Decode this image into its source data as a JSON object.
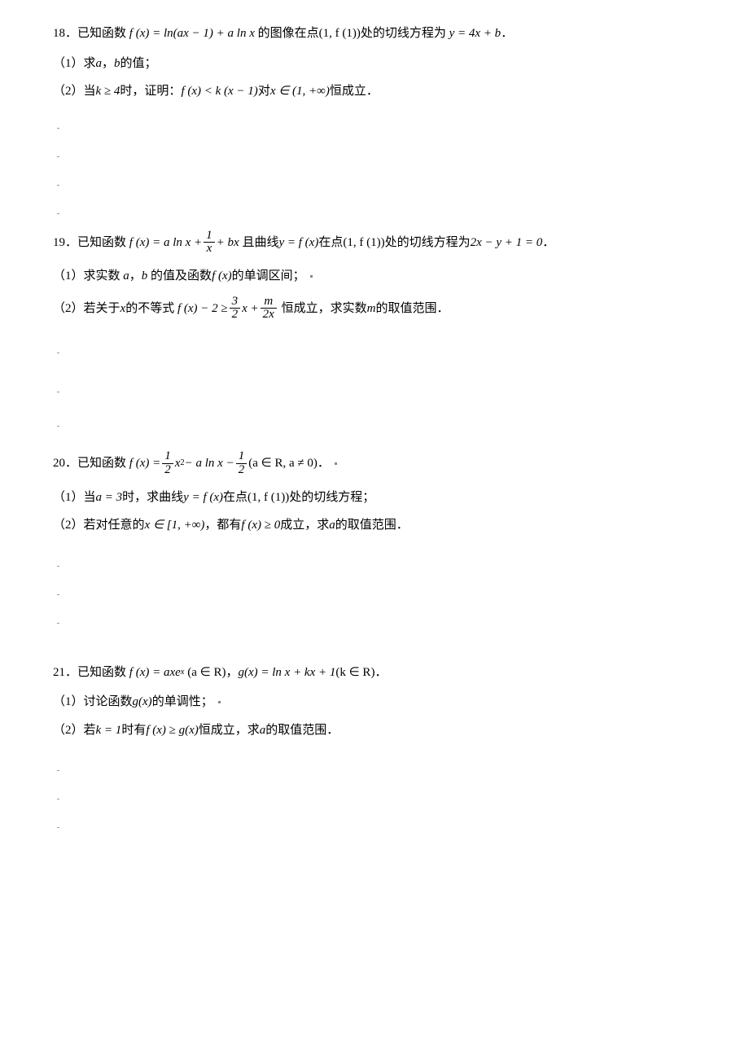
{
  "p18": {
    "num": "18．",
    "intro_a": "已知函数",
    "f_def": "f (x) = ln(ax − 1) + a ln x",
    "intro_b": "的图像在点",
    "point": "(1, f (1))",
    "intro_c": "处的切线方程为",
    "tangent": "y = 4x + b",
    "period": "．",
    "q1_label": "（1）",
    "q1_a": "求",
    "q1_var1": "a",
    "q1_comma": "，",
    "q1_var2": "b",
    "q1_b": "的值；",
    "q2_label": "（2）",
    "q2_a": "当",
    "q2_cond": "k ≥ 4",
    "q2_b": "时，证明：",
    "q2_ineq": "f (x) < k (x − 1)",
    "q2_c": "对",
    "q2_dom": "x ∈ (1, +∞)",
    "q2_d": "恒成立．"
  },
  "p19": {
    "num": "19．",
    "intro_a": "已知函数",
    "f_l": "f (x) = a ln x + ",
    "frac_num": "1",
    "frac_den": "x",
    "f_r": " + bx",
    "intro_b": "且曲线  ",
    "curve": "y = f (x)",
    "intro_c": "在点",
    "point": "(1, f (1))",
    "intro_d": "处的切线方程为",
    "tangent": "2x − y + 1 = 0",
    "period": "．",
    "q1_label": "（1）",
    "q1_a": "求实数",
    "q1_var1": "a",
    "q1_comma": "，",
    "q1_var2": "b",
    "q1_b": "的值及函数",
    "q1_fx": "f (x)",
    "q1_c": "的单调区间；",
    "q2_label": "（2）",
    "q2_a": "若关于",
    "q2_x": "x",
    "q2_b": "的不等式",
    "q2_lhs": "f (x) − 2 ≥ ",
    "q2_f1n": "3",
    "q2_f1d": "2",
    "q2_mid": " x + ",
    "q2_f2n": "m",
    "q2_f2d": "2x",
    "q2_c": "恒成立，求实数 ",
    "q2_m": "m",
    "q2_d": " 的取值范围．"
  },
  "p20": {
    "num": "20．",
    "intro_a": "已知函数",
    "f_l": "f (x) = ",
    "f1n": "1",
    "f1d": "2",
    "f_mid1": " x",
    "exp2": "2",
    "f_mid2": " − a ln x − ",
    "f2n": "1",
    "f2d": "2",
    "f_cond": "(a ∈ R, a ≠ 0)",
    "period": "．",
    "q1_label": "（1）",
    "q1_a": "当",
    "q1_cond": "a = 3",
    "q1_b": "时，求曲线",
    "q1_curve": "y = f (x)",
    "q1_c": "在点",
    "q1_point": "(1, f (1))",
    "q1_d": "处的切线方程；",
    "q2_label": "（2）",
    "q2_a": "若对任意的",
    "q2_dom": "x ∈ [1, +∞)",
    "q2_b": "，都有",
    "q2_ineq": "f (x) ≥ 0",
    "q2_c": "成立，求",
    "q2_var": "a",
    "q2_d": "的取值范围．"
  },
  "p21": {
    "num": "21．",
    "intro_a": "已知函数",
    "f_def": "f (x) = axe",
    "exp_x": "x",
    "f_cond": "(a ∈ R)",
    "comma": "，",
    "g_def": "g(x) = ln x + kx + 1",
    "g_cond": "(k ∈ R)",
    "period": "．",
    "q1_label": "（1）",
    "q1_a": "讨论函数",
    "q1_gx": "g(x)",
    "q1_b": "的单调性；",
    "q2_label": "（2）",
    "q2_a": "若",
    "q2_cond": "k = 1",
    "q2_b": "时有",
    "q2_ineq": "f (x) ≥ g(x)",
    "q2_c": "恒成立，求",
    "q2_var": "a",
    "q2_d": "的取值范围．"
  }
}
